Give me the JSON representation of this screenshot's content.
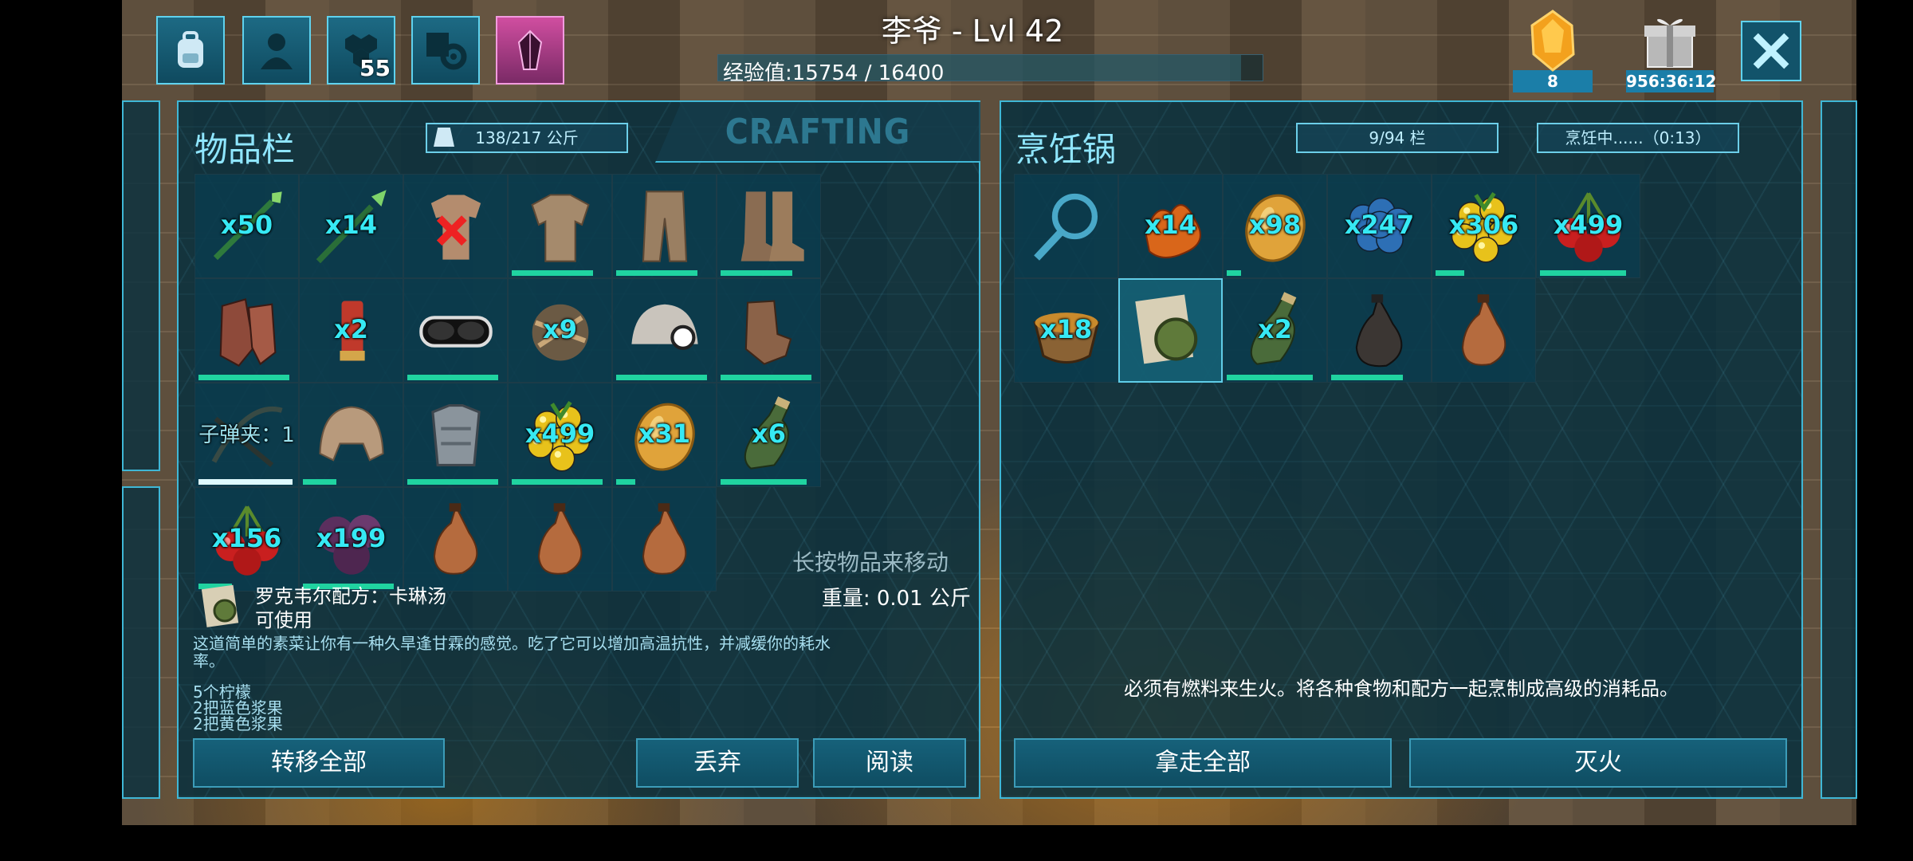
{
  "top": {
    "player_name": "李爷 - Lvl 42",
    "xp_text": "经验值:15754 / 16400",
    "xp_progress": 0.96,
    "engram_count": "55",
    "element_count": "8",
    "gift_timer": "956:36:12"
  },
  "inventory": {
    "title": "物品栏",
    "weight": "138/217 公斤",
    "crafting_tab": "CRAFTING",
    "slots": [
      {
        "icon": "arrow-icon",
        "qty": "x50",
        "bar": null
      },
      {
        "icon": "spear-icon",
        "qty": "x14",
        "bar": null
      },
      {
        "icon": "cloth-shirt-broken-icon",
        "qty": "",
        "bar": 0.0
      },
      {
        "icon": "cloth-shirt-icon",
        "qty": "",
        "bar": 0.85
      },
      {
        "icon": "cloth-pants-icon",
        "qty": "",
        "bar": 0.85
      },
      {
        "icon": "boots-icon",
        "qty": "",
        "bar": 0.75
      },
      {
        "icon": "gauntlets-icon",
        "qty": "",
        "bar": 0.95
      },
      {
        "icon": "cartridge-icon",
        "qty": "x2",
        "bar": null
      },
      {
        "icon": "goggles-icon",
        "qty": "",
        "bar": 0.95
      },
      {
        "icon": "bola-icon",
        "qty": "x9",
        "bar": null
      },
      {
        "icon": "miner-helmet-icon",
        "qty": "",
        "bar": 0.95
      },
      {
        "icon": "gloves-icon",
        "qty": "",
        "bar": 0.95
      },
      {
        "icon": "crossbow-icon",
        "qty": "子弹夹：1",
        "bar": 0.98,
        "bar_style": "white"
      },
      {
        "icon": "hide-hat-icon",
        "qty": "",
        "bar": 0.35
      },
      {
        "icon": "chest-armor-icon",
        "qty": "",
        "bar": 0.95
      },
      {
        "icon": "amarberry-icon",
        "qty": "x499",
        "bar": 0.95
      },
      {
        "icon": "citronal-icon",
        "qty": "x31",
        "bar": 0.2
      },
      {
        "icon": "water-bottle-icon",
        "qty": "x6",
        "bar": 0.9
      },
      {
        "icon": "tintoberry-icon",
        "qty": "x156",
        "bar": 0.35
      },
      {
        "icon": "narcoberry-icon",
        "qty": "x199",
        "bar": 0.95
      },
      {
        "icon": "waterskin-icon",
        "qty": "",
        "bar": null
      },
      {
        "icon": "waterskin-icon",
        "qty": "",
        "bar": null
      },
      {
        "icon": "waterskin-icon",
        "qty": "",
        "bar": null
      }
    ],
    "hint": "长按物品来移动",
    "selected_item": {
      "name": "罗克韦尔配方：卡琳汤",
      "status": "可使用",
      "weight": "重量: 0.01 公斤",
      "description": "这道简单的素菜让你有一种久旱逢甘霖的感觉。吃了它可以增加高温抗性，并减缓你的耗水率。",
      "ingredients": [
        "5个柠檬",
        "2把蓝色浆果",
        "2把黄色浆果"
      ]
    },
    "buttons": {
      "transfer_all": "转移全部",
      "drop": "丢弃",
      "read": "阅读"
    }
  },
  "cooking_pot": {
    "title": "烹饪锅",
    "slots_meter": "9/94 栏",
    "status_meter": "烹饪中......（0:13）",
    "slots": [
      {
        "icon": "search-icon",
        "qty": "",
        "bar": null
      },
      {
        "icon": "sparkpowder-icon",
        "qty": "x14",
        "bar": null
      },
      {
        "icon": "citronal-icon",
        "qty": "x98",
        "bar": 0.15
      },
      {
        "icon": "azulberry-icon",
        "qty": "x247",
        "bar": null
      },
      {
        "icon": "amarberry-icon",
        "qty": "x306",
        "bar": 0.3
      },
      {
        "icon": "tintoberry-icon",
        "qty": "x499",
        "bar": 0.9
      },
      {
        "icon": "soup-bowl-icon",
        "qty": "x18",
        "bar": null
      },
      {
        "icon": "recipe-note-icon",
        "qty": "",
        "bar": null,
        "selected": true
      },
      {
        "icon": "water-bottle-icon",
        "qty": "x2",
        "bar": 0.9
      },
      {
        "icon": "waterskin-dark-icon",
        "qty": "",
        "bar": 0.75
      },
      {
        "icon": "waterskin-icon",
        "qty": "",
        "bar": null
      }
    ],
    "hint": "必须有燃料来生火。将各种食物和配方一起烹制成高级的消耗品。",
    "buttons": {
      "take_all": "拿走全部",
      "extinguish": "灭火"
    }
  },
  "colors": {
    "accent": "#3fb7d6",
    "qty_text": "#36e9f4",
    "durability": "#20d3a0"
  }
}
